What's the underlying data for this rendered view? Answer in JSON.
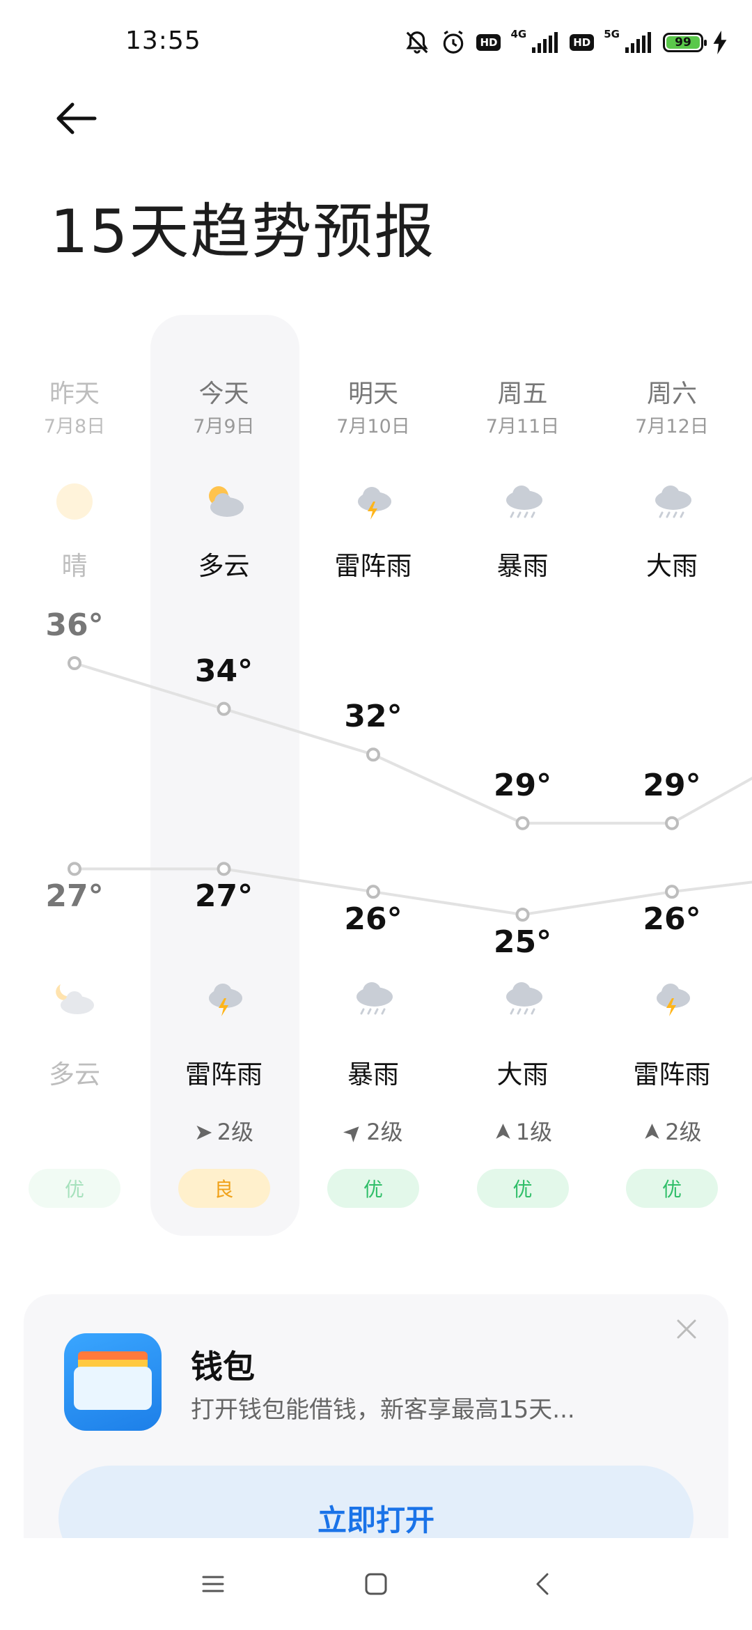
{
  "status_bar": {
    "time": "13:55",
    "net1": "4G",
    "net2": "5G",
    "hd": "HD",
    "battery": "99"
  },
  "header": {
    "title": "15天趋势预报"
  },
  "days": [
    {
      "name": "昨天",
      "date": "7月8日",
      "day_weather": "晴",
      "day_icon": "sun-icon",
      "high": "36°",
      "low": "27°",
      "night_weather": "多云",
      "night_icon": "cloudy-night-icon",
      "wind_dir": "",
      "wind_level": "",
      "aqi": "优"
    },
    {
      "name": "今天",
      "date": "7月9日",
      "day_weather": "多云",
      "day_icon": "partly-cloudy-icon",
      "high": "34°",
      "low": "27°",
      "night_weather": "雷阵雨",
      "night_icon": "thunderstorm-icon",
      "wind_dir": "➤",
      "wind_level": "2级",
      "aqi": "良"
    },
    {
      "name": "明天",
      "date": "7月10日",
      "day_weather": "雷阵雨",
      "day_icon": "thunderstorm-icon",
      "high": "32°",
      "low": "26°",
      "night_weather": "暴雨",
      "night_icon": "rain-icon",
      "wind_dir": "➤",
      "wind_level": "2级",
      "aqi": "优"
    },
    {
      "name": "周五",
      "date": "7月11日",
      "day_weather": "暴雨",
      "day_icon": "rain-icon",
      "high": "29°",
      "low": "25°",
      "night_weather": "大雨",
      "night_icon": "rain-icon",
      "wind_dir": "➤",
      "wind_level": "1级",
      "aqi": "优"
    },
    {
      "name": "周六",
      "date": "7月12日",
      "day_weather": "大雨",
      "day_icon": "rain-icon",
      "high": "29°",
      "low": "26°",
      "night_weather": "雷阵雨",
      "night_icon": "thunderstorm-icon",
      "wind_dir": "➤",
      "wind_level": "2级",
      "aqi": "优"
    }
  ],
  "chart_data": {
    "type": "line",
    "x": [
      "昨天",
      "今天",
      "明天",
      "周五",
      "周六"
    ],
    "series": [
      {
        "values": [
          36,
          34,
          32,
          29,
          29
        ]
      },
      {
        "values": [
          27,
          27,
          26,
          25,
          26
        ]
      }
    ]
  },
  "ad": {
    "title": "钱包",
    "description": "打开钱包能借钱，新客享最高15天...",
    "button": "立即打开"
  },
  "colors": {
    "aqi_good": "#2fbe68",
    "aqi_fair": "#f0a21a",
    "accent": "#1a73e8"
  }
}
